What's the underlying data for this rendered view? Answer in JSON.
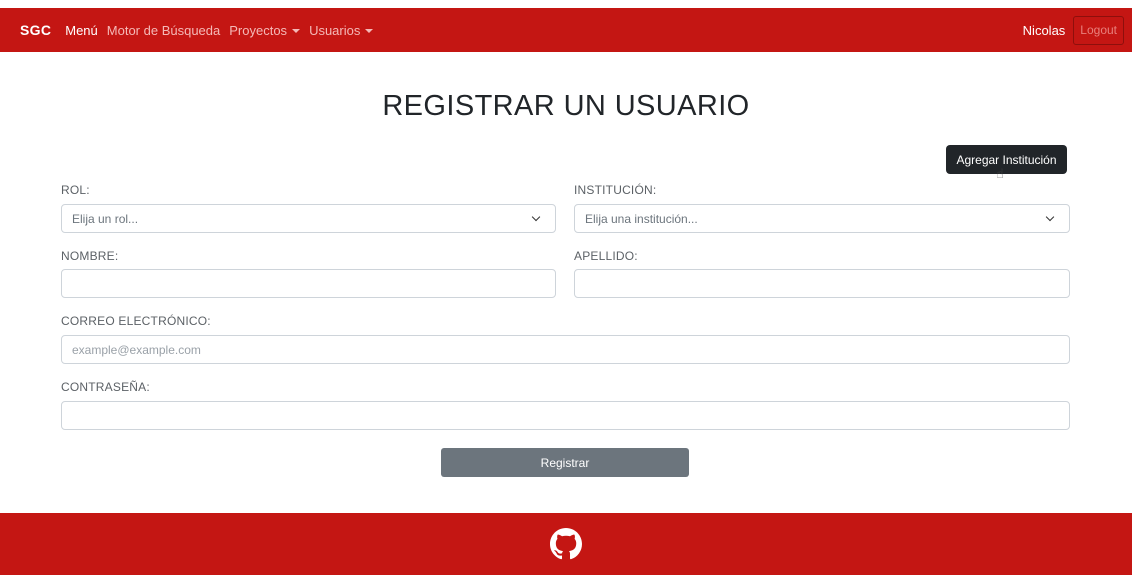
{
  "navbar": {
    "brand": "SGC",
    "items": [
      {
        "label": "Menú"
      },
      {
        "label": "Motor de Búsqueda"
      },
      {
        "label": "Proyectos"
      },
      {
        "label": "Usuarios"
      }
    ],
    "user_name": "Nicolas",
    "logout_label": "Logout"
  },
  "page": {
    "title": "REGISTRAR UN USUARIO"
  },
  "tooltip": {
    "label": "Agregar Institución"
  },
  "form": {
    "rol": {
      "label": "ROL:",
      "value": "Elija un rol..."
    },
    "institucion": {
      "label": "INSTITUCIÓN:",
      "value": "Elija una institución..."
    },
    "nombre": {
      "label": "NOMBRE:",
      "value": ""
    },
    "apellido": {
      "label": "APELLIDO:",
      "value": ""
    },
    "correo": {
      "label": "CORREO ELECTRÓNICO:",
      "placeholder": "example@example.com"
    },
    "contrasena": {
      "label": "CONTRASEÑA:",
      "value": ""
    },
    "submit_label": "Registrar"
  },
  "footer": {
    "icon": "github-icon"
  },
  "colors": {
    "brand_red": "#c41613",
    "button_gray": "#6c757d",
    "tooltip_dark": "#212529"
  }
}
